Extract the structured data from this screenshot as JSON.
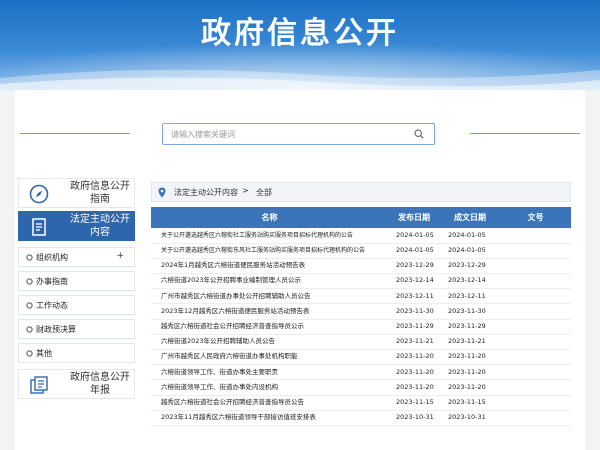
{
  "banner": {
    "title": "政府信息公开"
  },
  "search": {
    "placeholder": "请输入搜索关键词"
  },
  "sidebar": {
    "guide": {
      "label": "政府信息公开指南"
    },
    "content": {
      "label": "法定主动公开内容"
    },
    "menu": [
      {
        "label": "组织机构",
        "expand": "+"
      },
      {
        "label": "办事指南",
        "expand": ""
      },
      {
        "label": "工作动态",
        "expand": ""
      },
      {
        "label": "财政预决算",
        "expand": ""
      },
      {
        "label": "其他",
        "expand": ""
      }
    ],
    "annual": {
      "label": "政府信息公开年报"
    }
  },
  "breadcrumb": {
    "first": "法定主动公开内容",
    "separator": ">",
    "second": "全部"
  },
  "table": {
    "headers": [
      "名称",
      "发布日期",
      "成文日期",
      "文号"
    ],
    "rows": [
      {
        "name": "关于公开遴选越秀区六榕街社工服务站购买服务项目招标代理机构的公告",
        "published": "2024-01-05",
        "written": "2024-01-05",
        "doc": ""
      },
      {
        "name": "关于公开遴选越秀区六榕街东风社工服务站购买服务项目招标代理机构的公告",
        "published": "2024-01-05",
        "written": "2024-01-05",
        "doc": ""
      },
      {
        "name": "2024年1月越秀区六榕街道便民服务站活动预告表",
        "published": "2023-12-29",
        "written": "2023-12-29",
        "doc": ""
      },
      {
        "name": "六榕街道2023年公开招聘事业编制管理人员公示",
        "published": "2023-12-14",
        "written": "2023-12-14",
        "doc": ""
      },
      {
        "name": "广州市越秀区六榕街道办事处公开招聘辅助人员公告",
        "published": "2023-12-11",
        "written": "2023-12-11",
        "doc": ""
      },
      {
        "name": "2023年12月越秀区六榕街道便民服务站活动预告表",
        "published": "2023-11-30",
        "written": "2023-11-30",
        "doc": ""
      },
      {
        "name": "越秀区六榕街道社会公开招聘经济普查指导员公示",
        "published": "2023-11-29",
        "written": "2023-11-29",
        "doc": ""
      },
      {
        "name": "六榕街道2023年公开招聘辅助人员公告",
        "published": "2023-11-21",
        "written": "2023-11-21",
        "doc": ""
      },
      {
        "name": "广州市越秀区人民政府六榕街道办事处机构职能",
        "published": "2023-11-20",
        "written": "2023-11-20",
        "doc": ""
      },
      {
        "name": "六榕街道领导工作、街道办事处主要职责",
        "published": "2023-11-20",
        "written": "2023-11-20",
        "doc": ""
      },
      {
        "name": "六榕街道领导工作、街道办事处内设机构",
        "published": "2023-11-20",
        "written": "2023-11-20",
        "doc": ""
      },
      {
        "name": "越秀区六榕街道社会公开招聘经济普查指导员公告",
        "published": "2023-11-15",
        "written": "2023-11-15",
        "doc": ""
      },
      {
        "name": "2023年11月越秀区六榕街道领导干部接访值班安排表",
        "published": "2023-10-31",
        "written": "2023-10-31",
        "doc": ""
      }
    ]
  },
  "colors": {
    "banner": "#1d6fc3",
    "accent": "#2e66ad",
    "table_header": "#3b74b8"
  }
}
